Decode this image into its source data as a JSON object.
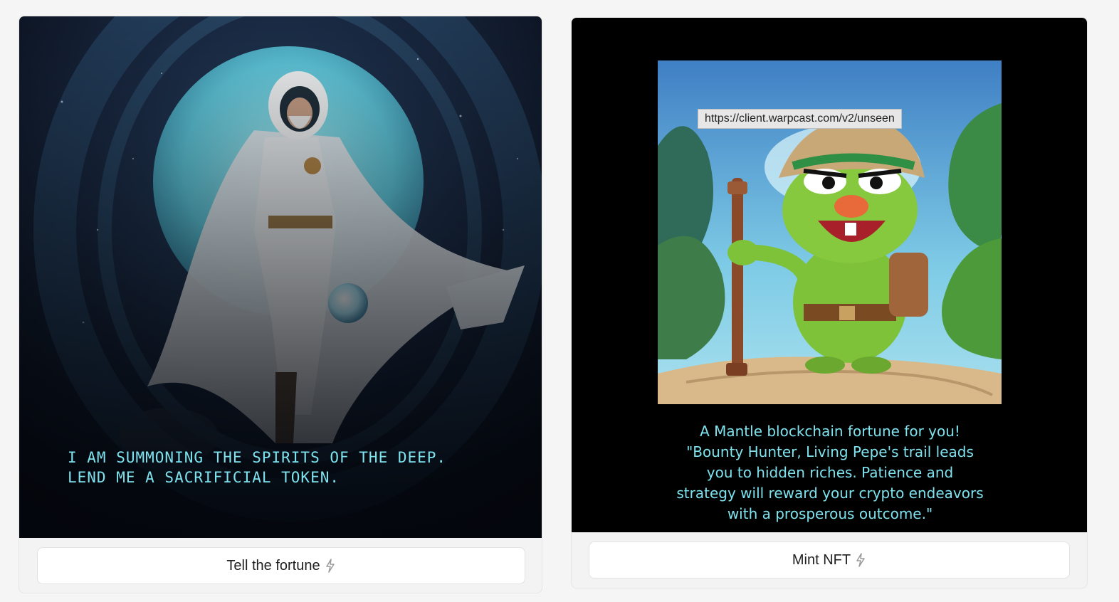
{
  "frames": [
    {
      "text_lines": [
        "I AM SUMMONING THE SPIRITS OF THE DEEP.",
        "LEND ME A SACRIFICIAL TOKEN."
      ],
      "button_label": "Tell the fortune",
      "button_icon": "bolt-icon"
    },
    {
      "tooltip": "https://client.warpcast.com/v2/unseen",
      "text_lines": [
        "A Mantle blockchain fortune for you!",
        "\"Bounty Hunter,  Living Pepe's trail leads",
        "you to hidden riches. Patience and",
        "strategy will reward your crypto endeavors",
        "with a prosperous outcome.\""
      ],
      "button_label": "Mint NFT",
      "button_icon": "bolt-icon"
    }
  ],
  "colors": {
    "page_bg": "#f5f5f5",
    "text_accent": "#7ee3ee",
    "button_bg": "#ffffff"
  }
}
